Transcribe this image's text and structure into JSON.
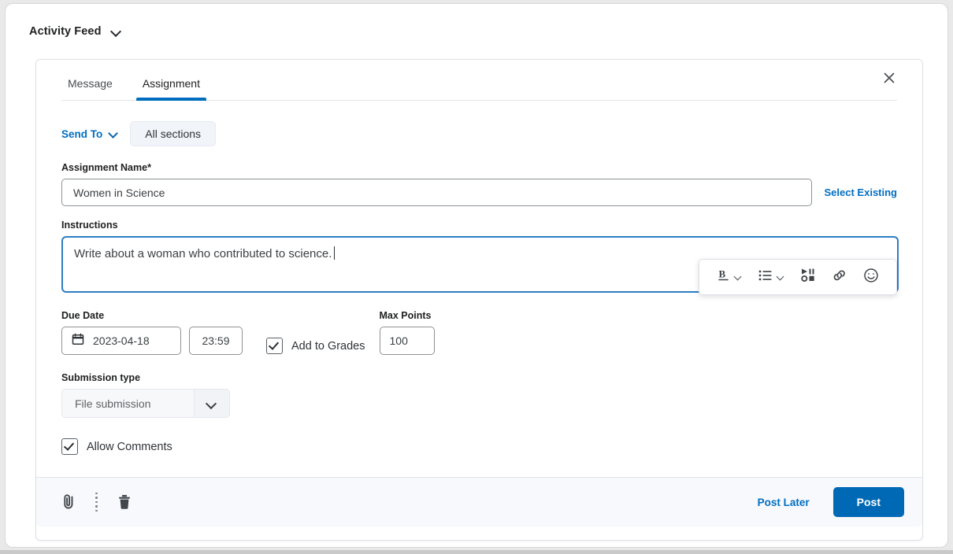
{
  "header": {
    "title": "Activity Feed",
    "chevron_icon": "chevron-down-icon"
  },
  "composer": {
    "tabs": [
      {
        "label": "Message",
        "active": false
      },
      {
        "label": "Assignment",
        "active": true
      }
    ],
    "close_icon": "close-icon",
    "send_to": {
      "label": "Send To",
      "chevron_icon": "chevron-down-icon",
      "selection": "All sections"
    },
    "assignment_name": {
      "label": "Assignment Name",
      "required_marker": "*",
      "value": "Women in Science",
      "placeholder": "Assignment Name",
      "select_existing_label": "Select Existing"
    },
    "instructions": {
      "label": "Instructions",
      "value": "Write about a woman who contributed to science.",
      "toolbar": [
        {
          "icon": "bold-icon",
          "label": "B",
          "has_chevron": true
        },
        {
          "icon": "bulleted-list-icon",
          "label": "",
          "has_chevron": true
        },
        {
          "icon": "insert-media-icon",
          "label": "",
          "has_chevron": false
        },
        {
          "icon": "link-icon",
          "label": "",
          "has_chevron": false
        },
        {
          "icon": "emoji-icon",
          "label": "",
          "has_chevron": false
        }
      ]
    },
    "due_date": {
      "label": "Due Date",
      "date_value": "2023-04-18",
      "calendar_icon": "calendar-icon",
      "time_value": "23:59"
    },
    "add_to_grades": {
      "label": "Add to Grades",
      "checked": true
    },
    "max_points": {
      "label": "Max Points",
      "value": "100"
    },
    "submission_type": {
      "label": "Submission type",
      "value": "File submission",
      "chevron_icon": "chevron-down-icon",
      "options": [
        "File submission"
      ]
    },
    "allow_comments": {
      "label": "Allow Comments",
      "checked": true
    },
    "footer": {
      "attach_icon": "paperclip-icon",
      "more_icon": "more-vertical-icon",
      "delete_icon": "trash-icon",
      "post_later_label": "Post Later",
      "post_label": "Post"
    }
  },
  "colors": {
    "accent_blue": "#006ec0",
    "post_button": "#0069b5",
    "editor_focus_border": "#2d7dc4",
    "footer_background": "#f8f9fc"
  }
}
